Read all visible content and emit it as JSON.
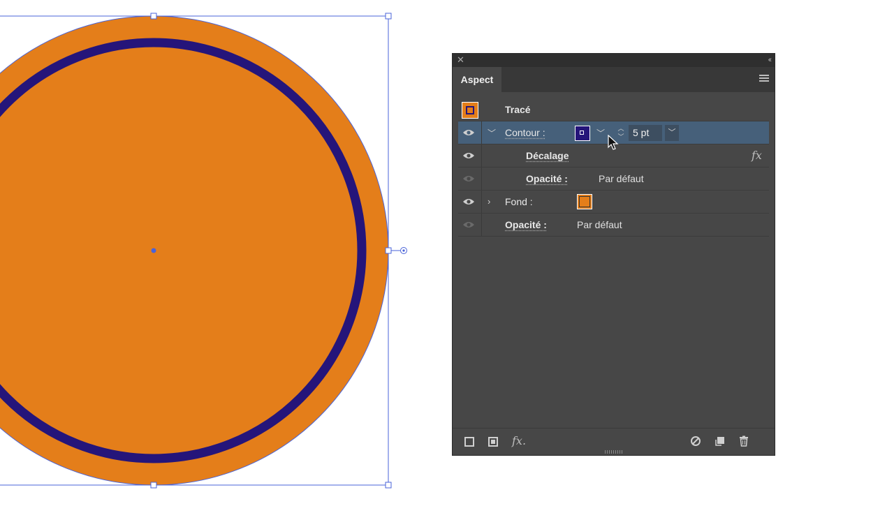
{
  "colors": {
    "fill": "#e47e1a",
    "stroke": "#25157a",
    "selection": "#4a63d8",
    "panel_bg": "#474747",
    "row_selected": "#46607a"
  },
  "panel": {
    "close_icon": "close-icon",
    "collapse_icon": "collapse-icon",
    "tab_label": "Aspect",
    "menu_icon": "panel-menu-icon"
  },
  "rows": {
    "object": {
      "label": "Tracé"
    },
    "stroke": {
      "label": "Contour :",
      "weight": "5 pt"
    },
    "offset": {
      "label": "Décalage",
      "fx": "fx"
    },
    "stroke_opacity": {
      "label": "Opacité :",
      "value": "Par défaut"
    },
    "fill": {
      "label": "Fond :"
    },
    "opacity": {
      "label": "Opacité :",
      "value": "Par défaut"
    }
  },
  "bottom": {
    "fx": "fx."
  }
}
